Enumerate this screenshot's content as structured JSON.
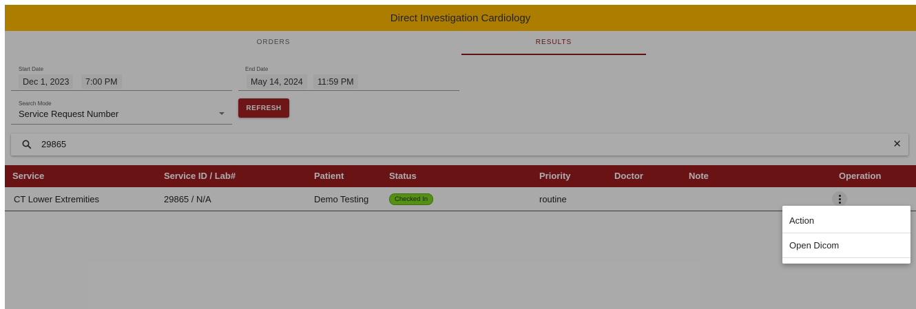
{
  "app": {
    "title": "Direct Investigation Cardiology"
  },
  "tabs": [
    {
      "label": "ORDERS",
      "active": false
    },
    {
      "label": "RESULTS",
      "active": true
    }
  ],
  "filters": {
    "start": {
      "label": "Start Date",
      "date": "Dec 1, 2023",
      "time": "7:00 PM"
    },
    "end": {
      "label": "End Date",
      "date": "May 14, 2024",
      "time": "11:59 PM"
    },
    "search_mode": {
      "label": "Search Mode",
      "value": "Service Request Number"
    },
    "refresh_label": "REFRESH"
  },
  "search": {
    "value": "29865",
    "icon": "search-icon",
    "clear_icon": "close-icon"
  },
  "table": {
    "columns": [
      "Service",
      "Service ID / Lab#",
      "Patient",
      "Status",
      "Priority",
      "Doctor",
      "Note",
      "Operation"
    ],
    "rows": [
      {
        "service": "CT Lower Extremities",
        "service_id": "29865 / N/A",
        "patient": "Demo Testing",
        "status": "Checked In",
        "priority": "routine",
        "doctor": "",
        "note": ""
      }
    ]
  },
  "menu": {
    "items": [
      "Action",
      "Open Dicom"
    ]
  },
  "colors": {
    "header": "#ffb900",
    "accent": "#9b1c1f",
    "status_checked_in": "#7ed321"
  }
}
